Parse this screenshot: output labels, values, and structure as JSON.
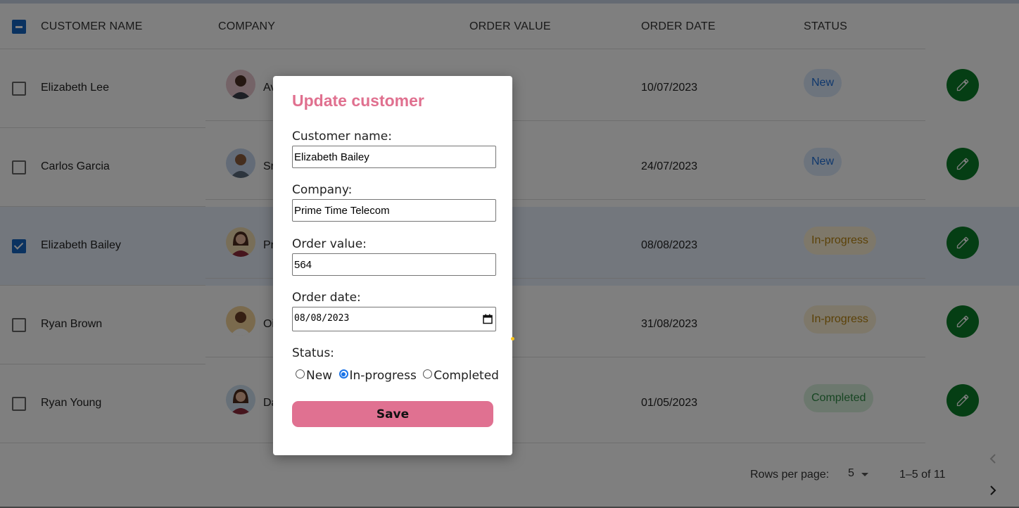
{
  "table": {
    "headers": {
      "customer_name": "CUSTOMER NAME",
      "company": "COMPANY",
      "order_value": "ORDER VALUE",
      "order_date": "ORDER DATE",
      "status": "STATUS"
    },
    "rows": [
      {
        "customer": "Elizabeth Lee",
        "company": "Av",
        "date": "10/07/2023",
        "status": "New",
        "selected": false
      },
      {
        "customer": "Carlos Garcia",
        "company": "Sr",
        "date": "24/07/2023",
        "status": "New",
        "selected": false
      },
      {
        "customer": "Elizabeth Bailey",
        "company": "Pr",
        "date": "08/08/2023",
        "status": "In-progress",
        "selected": true
      },
      {
        "customer": "Ryan Brown",
        "company": "Oi",
        "date": "31/08/2023",
        "status": "In-progress",
        "selected": false
      },
      {
        "customer": "Ryan Young",
        "company": "Da",
        "date": "01/05/2023",
        "status": "Completed",
        "selected": false
      }
    ]
  },
  "pagination": {
    "rows_per_page_label": "Rows per page:",
    "rows_per_page_value": "5",
    "range": "1–5 of 11"
  },
  "modal": {
    "title": "Update customer",
    "customer_name_label": "Customer name:",
    "customer_name_value": "Elizabeth Bailey",
    "company_label": "Company:",
    "company_value": "Prime Time Telecom",
    "order_value_label": "Order value:",
    "order_value_value": "564",
    "order_date_label": "Order date:",
    "order_date_value": "08/08/2023",
    "status_label": "Status:",
    "status_options": [
      "New",
      "In-progress",
      "Completed"
    ],
    "status_selected": "In-progress",
    "save_label": "Save"
  },
  "colors": {
    "accent_pink": "#e07191",
    "edit_green": "#0b7d28",
    "checkbox_blue": "#1565c0"
  }
}
